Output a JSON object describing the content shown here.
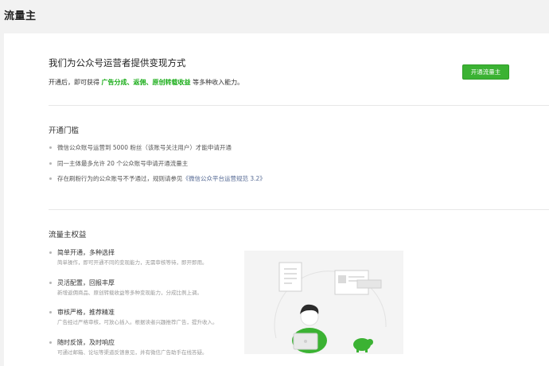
{
  "header": {
    "title": "流量主"
  },
  "intro": {
    "heading": "我们为公众号运营者提供变现方式",
    "desc_prefix": "开通后，即可获得 ",
    "desc_highlight": "广告分成、返佣、原创转载收益",
    "desc_suffix": " 等多种收入能力。",
    "open_button": "开通流量主"
  },
  "requirements": {
    "title": "开通门槛",
    "items": [
      {
        "text": "微信公众账号运营到 5000 粉丝（该账号关注用户）才能申请开通"
      },
      {
        "text": "同一主体最多允许 20 个公众账号申请开通流量主"
      },
      {
        "text": "存在刷粉行为的公众账号不予通过，规则请参见",
        "link": "《微信公众平台运营规范 3.2》"
      }
    ]
  },
  "benefits": {
    "title": "流量主权益",
    "items": [
      {
        "title": "简单开通，多种选择",
        "desc": "简单操作，即可开通不同的变现能力，无需审核等待，即开即用。"
      },
      {
        "title": "灵活配置，回报丰厚",
        "desc": "新增返佣商品、原创转载收益等多种变现能力，分成比例上调。"
      },
      {
        "title": "审核严格，推荐精准",
        "desc": "广告经过严格审核，可放心插入。根据读者兴趣推荐广告，提升收入。"
      },
      {
        "title": "随时反馈，及时响应",
        "desc": "可通过邮箱、论坛等渠道反馈意见，并有微信广告助手在线答疑。"
      }
    ]
  },
  "colors": {
    "accent": "#1aad19",
    "button": "#3bb233",
    "link": "#576b95"
  }
}
